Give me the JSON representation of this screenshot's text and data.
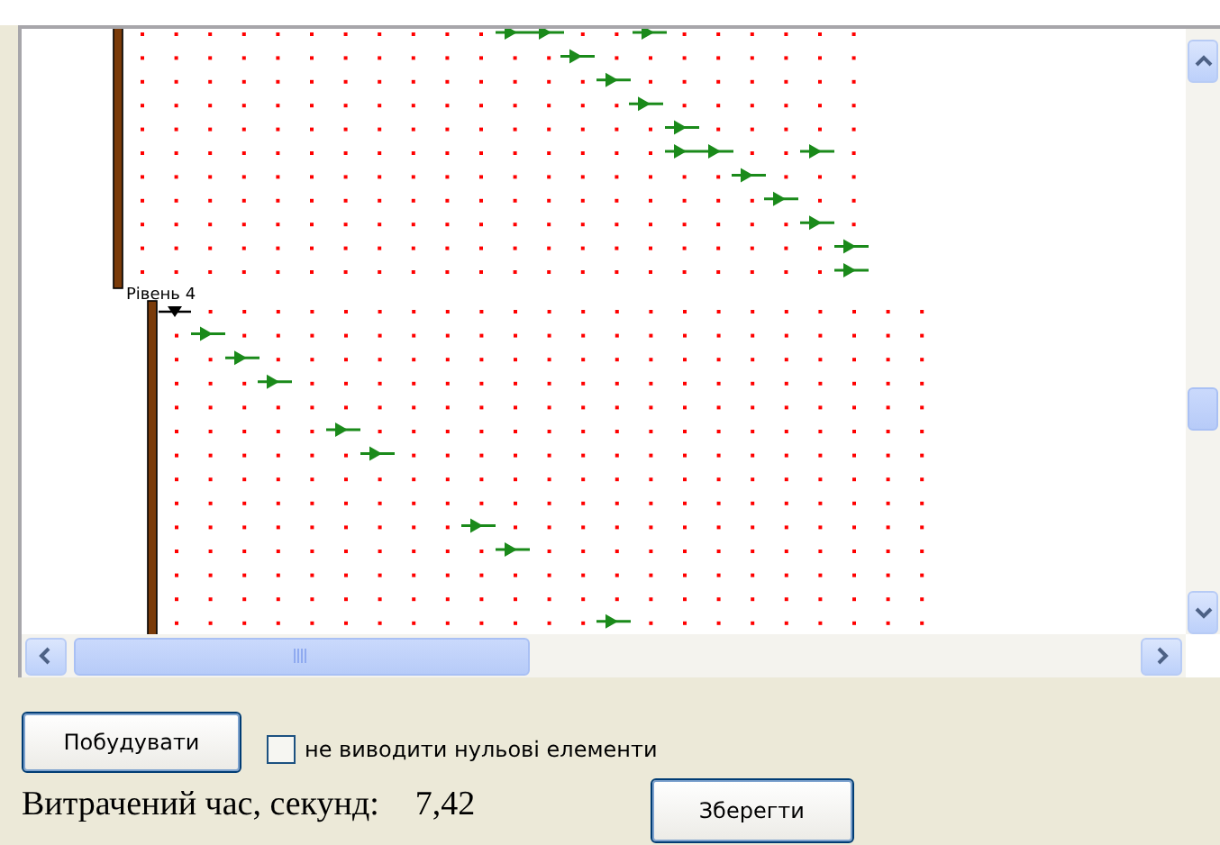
{
  "canvas": {
    "level_label": "Рівень 4"
  },
  "build_button": {
    "label": "Побудувати"
  },
  "hide_zeros": {
    "label": "не виводити нульові елементи",
    "checked": false
  },
  "elapsed": {
    "label": "Витрачений час, секунд:",
    "value": "7,42"
  },
  "save_button": {
    "label": "Зберегти"
  }
}
